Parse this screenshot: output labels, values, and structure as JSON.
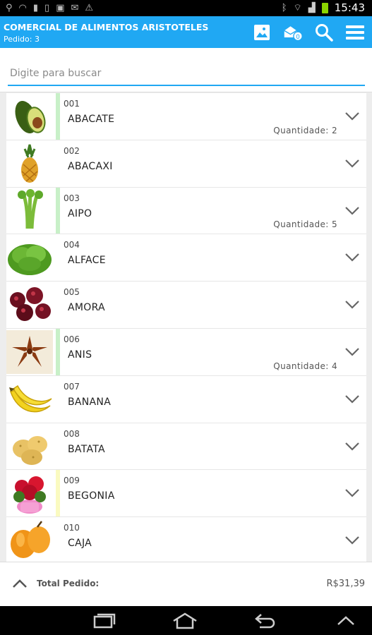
{
  "status_bar": {
    "left_icons": [
      "usb-icon",
      "wifi-icon",
      "sd-card-icon",
      "sim-icon",
      "image-icon",
      "mail-icon",
      "warning-icon"
    ],
    "right_icons": [
      "bluetooth-icon",
      "wifi-signal-icon",
      "cell-signal-icon",
      "battery-icon"
    ],
    "time": "15:43"
  },
  "app_bar": {
    "title": "COMERCIAL DE ALIMENTOS ARISTOTELES",
    "subtitle": "Pedido: 3",
    "actions": [
      "image-icon",
      "mail-box-icon",
      "search-icon",
      "menu-icon"
    ],
    "mail_badge": "0",
    "color": "#20a8f3"
  },
  "search": {
    "placeholder": "Digite para buscar",
    "value": ""
  },
  "products": [
    {
      "code": "001",
      "name": "ABACATE",
      "quantity": "Quantidade: 2",
      "marker": "#c8f0c8",
      "image": "avocado"
    },
    {
      "code": "002",
      "name": "ABACAXI",
      "quantity": "",
      "marker": "",
      "image": "pineapple"
    },
    {
      "code": "003",
      "name": "AIPO",
      "quantity": "Quantidade: 5",
      "marker": "#c8f0c8",
      "image": "celery"
    },
    {
      "code": "004",
      "name": "ALFACE",
      "quantity": "",
      "marker": "",
      "image": "lettuce"
    },
    {
      "code": "005",
      "name": "AMORA",
      "quantity": "",
      "marker": "",
      "image": "blackberry"
    },
    {
      "code": "006",
      "name": "ANIS",
      "quantity": "Quantidade: 4",
      "marker": "#c8f0c8",
      "image": "star-anise"
    },
    {
      "code": "007",
      "name": "BANANA",
      "quantity": "",
      "marker": "",
      "image": "banana"
    },
    {
      "code": "008",
      "name": "BATATA",
      "quantity": "",
      "marker": "",
      "image": "potato"
    },
    {
      "code": "009",
      "name": "BEGONIA",
      "quantity": "",
      "marker": "#fafac0",
      "image": "begonia"
    },
    {
      "code": "010",
      "name": "CAJA",
      "quantity": "",
      "marker": "",
      "image": "caja"
    }
  ],
  "footer": {
    "label": "Total Pedido:",
    "value": "R$31,39"
  },
  "nav_bar": {
    "buttons": [
      "recent-apps-icon",
      "home-icon",
      "back-icon",
      "chevron-up-icon"
    ]
  }
}
